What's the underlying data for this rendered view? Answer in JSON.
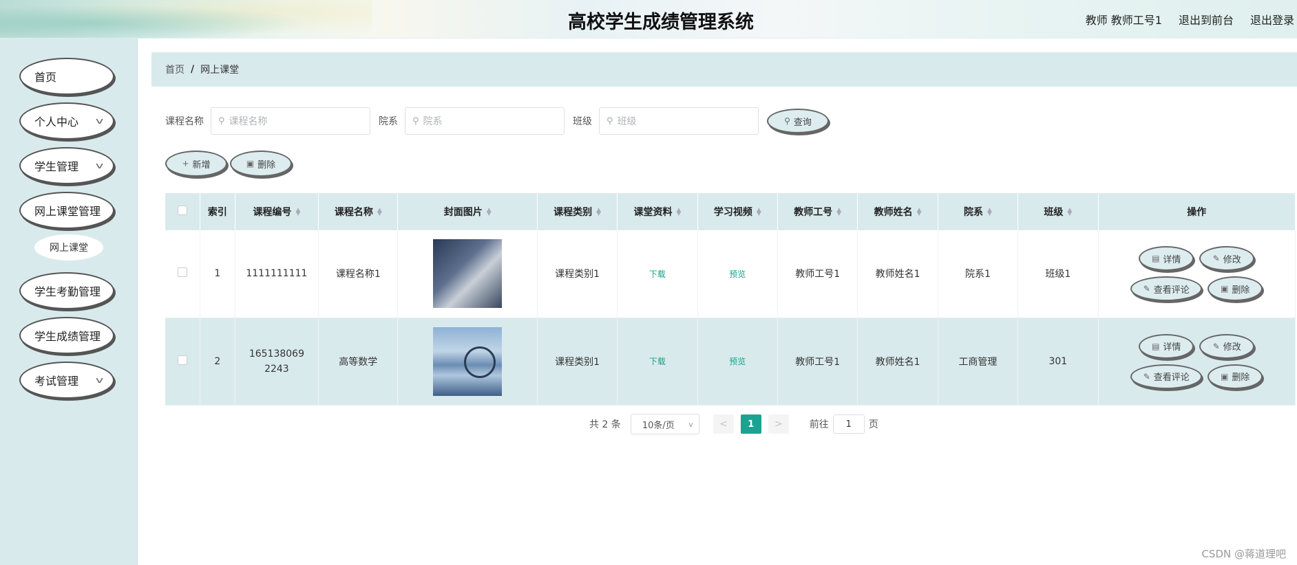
{
  "header": {
    "title": "高校学生成绩管理系统",
    "user": "教师 教师工号1",
    "exit_front": "退出到前台",
    "logout": "退出登录"
  },
  "sidebar": {
    "items": [
      {
        "label": "首页",
        "chevron": false
      },
      {
        "label": "个人中心",
        "chevron": true
      },
      {
        "label": "学生管理",
        "chevron": true
      },
      {
        "label": "网上课堂管理",
        "chevron": false
      },
      {
        "label": "学生考勤管理",
        "chevron": false
      },
      {
        "label": "学生成绩管理",
        "chevron": false
      },
      {
        "label": "考试管理",
        "chevron": true
      }
    ],
    "submenu": "网上课堂"
  },
  "breadcrumb": {
    "home": "首页",
    "sep": "/",
    "current": "网上课堂"
  },
  "search": {
    "course_label": "课程名称",
    "course_placeholder": "课程名称",
    "dept_label": "院系",
    "dept_placeholder": "院系",
    "class_label": "班级",
    "class_placeholder": "班级",
    "query": "查询"
  },
  "actions": {
    "add": "新增",
    "delete": "删除"
  },
  "table": {
    "headers": [
      "索引",
      "课程编号",
      "课程名称",
      "封面图片",
      "课程类别",
      "课堂资料",
      "学习视频",
      "教师工号",
      "教师姓名",
      "院系",
      "班级",
      "操作"
    ],
    "rows": [
      {
        "index": "1",
        "code": "1111111111",
        "name": "课程名称1",
        "category": "课程类别1",
        "material": "下载",
        "video": "预览",
        "teacher_id": "教师工号1",
        "teacher_name": "教师姓名1",
        "dept": "院系1",
        "class": "班级1"
      },
      {
        "index": "2",
        "code": "1651380692243",
        "name": "高等数学",
        "category": "课程类别1",
        "material": "下载",
        "video": "预览",
        "teacher_id": "教师工号1",
        "teacher_name": "教师姓名1",
        "dept": "工商管理",
        "class": "301"
      }
    ],
    "ops": {
      "detail": "详情",
      "edit": "修改",
      "review": "查看评论",
      "delete": "删除"
    }
  },
  "pager": {
    "total": "共 2 条",
    "size": "10条/页",
    "current": "1",
    "goto_prefix": "前往",
    "goto_value": "1",
    "goto_suffix": "页"
  },
  "watermark": "CSDN @蒋道理吧",
  "colors": {
    "accent": "#1aa391",
    "sidebar_bg": "#d9eaed"
  }
}
